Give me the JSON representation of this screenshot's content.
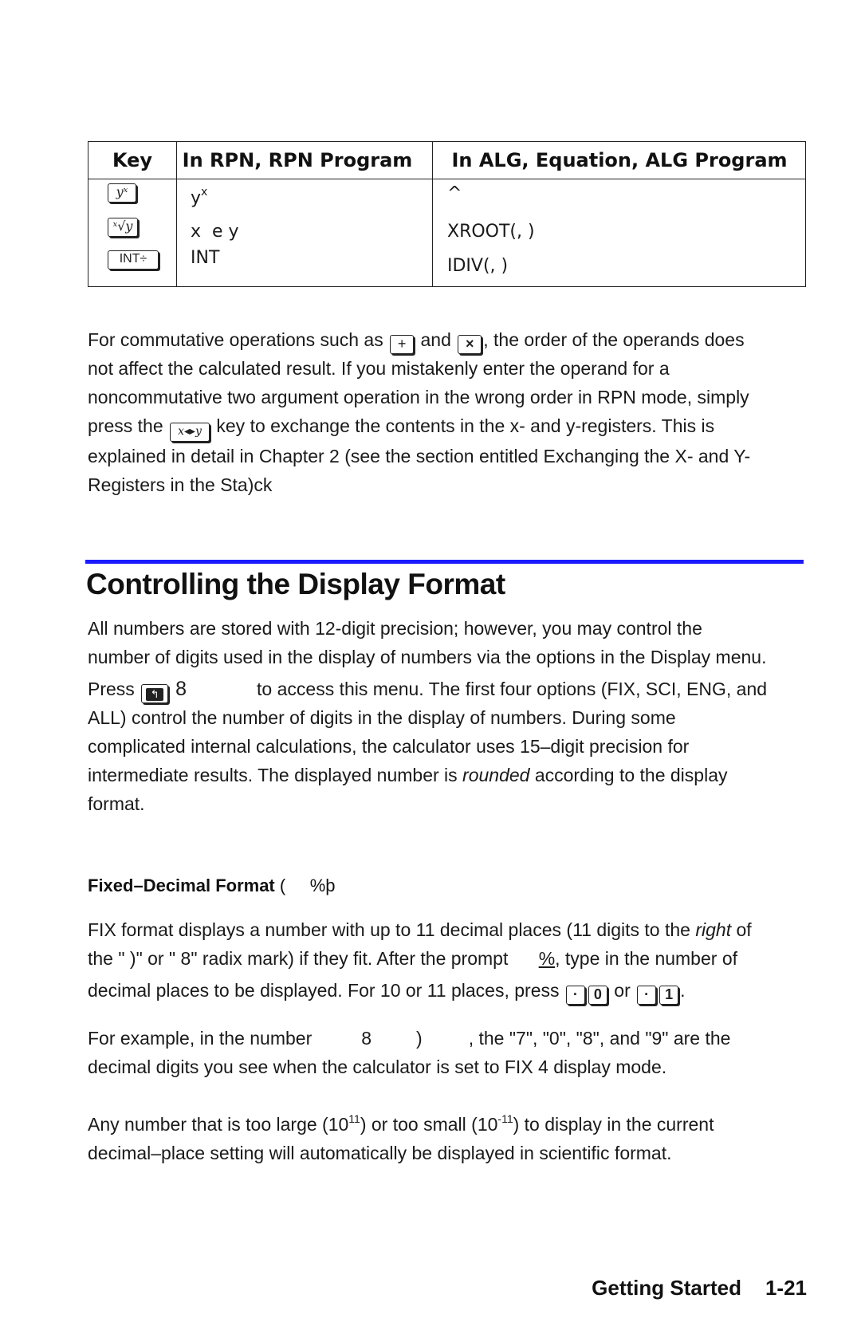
{
  "table": {
    "headers": [
      "Key",
      "In RPN, RPN Program",
      "In ALG, Equation, ALG Program"
    ],
    "rows": [
      {
        "key_label": "yˣ",
        "key_icon": "y-power-x-key-icon",
        "rpn_base": "y",
        "rpn_sup": "x",
        "alg": "^"
      },
      {
        "key_label": "ˣ√y",
        "key_icon": "x-root-y-key-icon",
        "rpn": "x  e y",
        "alg": "XROOT(, )"
      },
      {
        "key_label": "INT÷",
        "key_icon": "int-divide-key-icon",
        "rpn": "INT",
        "alg": "IDIV(, )"
      }
    ]
  },
  "para1": {
    "l1_a": "For commutative operations such as ",
    "key_plus": "+",
    "l1_b": " and ",
    "key_times": "×",
    "l1_c": ", the order of the operands does",
    "l2": "not affect the calculated result. If you mistakenly enter the operand for a",
    "l3": "noncommutative two argument operation in the wrong order in RPN mode, simply",
    "l4_a": "press the ",
    "key_swap": "x◂▸y",
    "l4_b": " key to exchange the contents in the x- and y-registers. This is",
    "l5": "explained in detail in Chapter 2 (see the section entitled Exchanging the X- and Y-",
    "l6": "Registers in the Sta)ck"
  },
  "section": {
    "title": "Controlling the Display Format"
  },
  "para2": {
    "l1": "All numbers are stored with 12-digit precision; however, you may control the",
    "l2": "number of digits used in the display of numbers via the options in the Display menu.",
    "l3_a": "Press ",
    "key_shift": "↰",
    "l3_b": " 8",
    "l3_c": "to access this menu. The first four options (FIX, SCI, ENG, and",
    "l4": "ALL) control the number of digits in the display of numbers. During some",
    "l5": "complicated internal calculations, the calculator uses 15–digit precision for",
    "l6_a": "intermediate results. The displayed number is ",
    "l6_em": "rounded",
    "l6_b": " according to the display",
    "l7": "format."
  },
  "subsection": {
    "title_bold": "Fixed–Decimal Format",
    "title_rest": " (     %þ"
  },
  "para3": {
    "l1_a": "FIX format displays a number with up to 11 decimal places (11 digits to the ",
    "l1_em": "right",
    "l1_b": " of",
    "l2_a": "the \" )\" or \" 8\" radix mark) if they fit. After the prompt      ",
    "l2_u": "%",
    "l2_b": ", type in the number of",
    "l3_a": "decimal places to be displayed. For 10 or 11 places, press ",
    "key_dot": "·",
    "key_0": "0",
    "l3_or": " or ",
    "key_1": "1",
    "l3_end": "."
  },
  "para4": {
    "l1_a": "For example, in the number",
    "l1_n1": "8",
    "l1_n2": ")",
    "l1_b": ", the \"7\", \"0\", \"8\", and \"9\" are the",
    "l2": "decimal digits you see when the calculator is set to FIX 4 display mode."
  },
  "para5": {
    "l1_a": "Any number that is too large (10",
    "sup1": "11",
    "l1_b": ") or too small (10",
    "sup2": "-11",
    "l1_c": ") to display in the current",
    "l2": "decimal–place setting will automatically be displayed in scientific format."
  },
  "footer": {
    "chapter": "Getting Started",
    "page": "1-21"
  },
  "colors": {
    "rule": "#1a1aff",
    "text": "#1a1a1a"
  }
}
